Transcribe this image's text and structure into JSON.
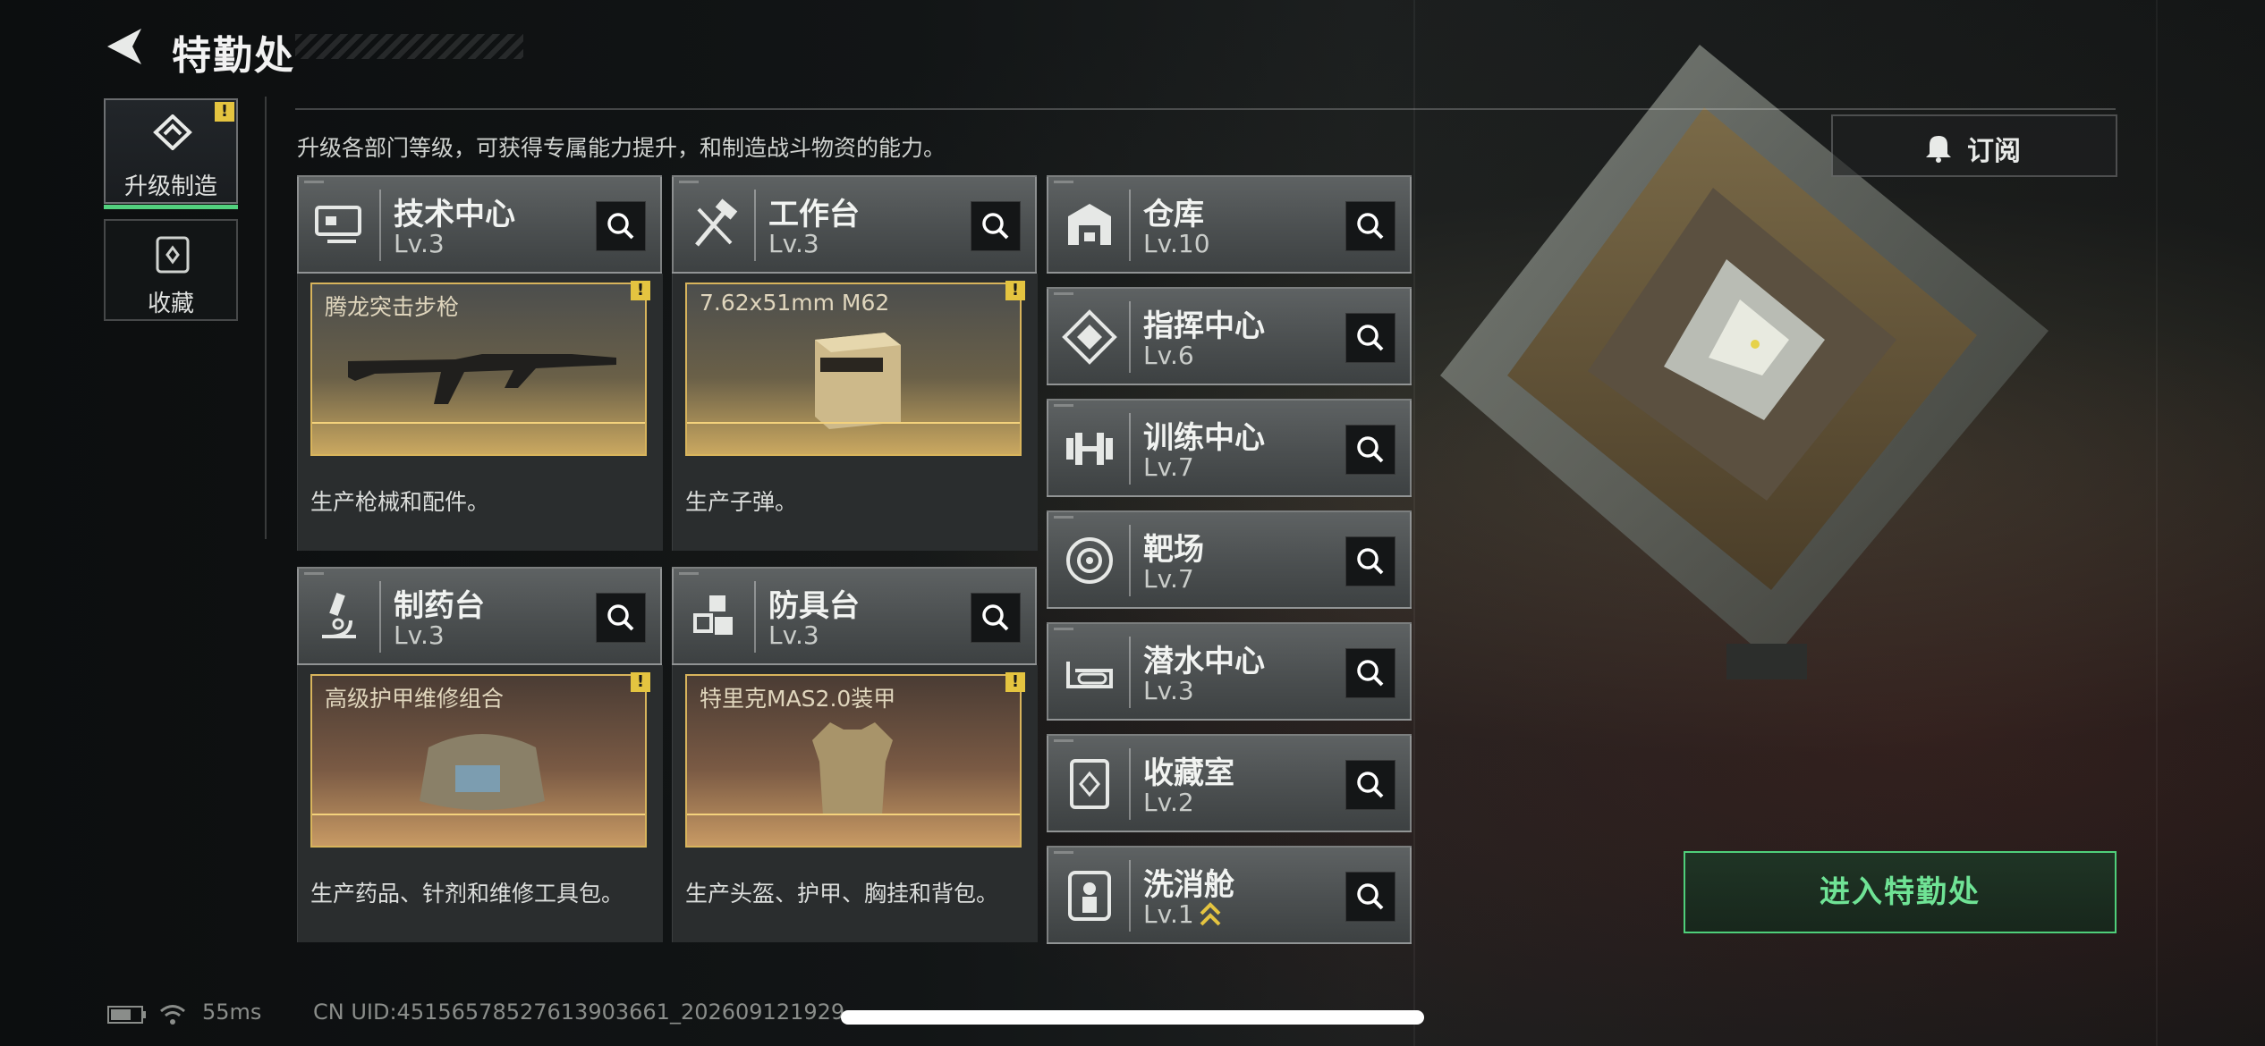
{
  "header": {
    "title": "特勤处"
  },
  "nav": [
    {
      "label": "升级制造",
      "active": true,
      "alert": "!"
    },
    {
      "label": "收藏",
      "active": false
    }
  ],
  "description": "升级各部门等级，可获得专属能力提升，和制造战斗物资的能力。",
  "facilities_grid": [
    {
      "name": "技术中心",
      "level": "Lv.3",
      "icon": "monitor-icon",
      "product": "腾龙突击步枪",
      "product_alert": "!",
      "desc": "生产枪械和配件。"
    },
    {
      "name": "工作台",
      "level": "Lv.3",
      "icon": "tools-icon",
      "product": "7.62x51mm M62",
      "product_alert": "!",
      "desc": "生产子弹。"
    },
    {
      "name": "制药台",
      "level": "Lv.3",
      "icon": "microscope-icon",
      "product": "高级护甲维修组合",
      "product_alert": "!",
      "desc": "生产药品、针剂和维修工具包。"
    },
    {
      "name": "防具台",
      "level": "Lv.3",
      "icon": "cubes-icon",
      "product": "特里克MAS2.0装甲",
      "product_alert": "!",
      "desc": "生产头盔、护甲、胸挂和背包。"
    }
  ],
  "facilities_list": [
    {
      "name": "仓库",
      "level": "Lv.10",
      "icon": "warehouse-icon"
    },
    {
      "name": "指挥中心",
      "level": "Lv.6",
      "icon": "command-icon"
    },
    {
      "name": "训练中心",
      "level": "Lv.7",
      "icon": "dumbbell-icon"
    },
    {
      "name": "靶场",
      "level": "Lv.7",
      "icon": "target-icon"
    },
    {
      "name": "潜水中心",
      "level": "Lv.3",
      "icon": "diving-mask-icon"
    },
    {
      "name": "收藏室",
      "level": "Lv.2",
      "icon": "collection-icon"
    },
    {
      "name": "洗消舱",
      "level": "Lv.1",
      "icon": "decon-icon",
      "upgrade_available": true
    }
  ],
  "subscribe_label": "订阅",
  "enter_label": "进入特勤处",
  "status": {
    "ping": "55ms",
    "uid": "CN UID:451565785276139036​61_202609121929"
  },
  "colors": {
    "accent_green": "#52d17e",
    "gold": "#d8b45c",
    "warning": "#e4c440"
  }
}
